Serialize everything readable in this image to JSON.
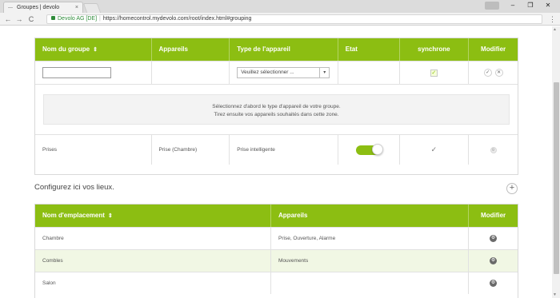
{
  "browser": {
    "tab_title": "Groupes | devolo",
    "tab_close": "×",
    "window_minimize": "–",
    "window_maximize": "❐",
    "window_close": "✕",
    "nav_back": "←",
    "nav_forward": "→",
    "nav_reload": "C",
    "secure_label": "Devolo AG [DE]",
    "url": "https://homecontrol.mydevolo.com/root/index.html#grouping",
    "bookmark_star": "☆",
    "menu_icon": "⋮"
  },
  "groups_table": {
    "headers": {
      "name": "Nom du groupe",
      "devices": "Appareils",
      "device_type": "Type de l'appareil",
      "state": "Etat",
      "sync": "synchrone",
      "modify": "Modifier"
    },
    "sort_icon": "⇕",
    "new_group": {
      "name_value": "",
      "device_type_placeholder": "Veuillez sélectionner ...",
      "caret": "▾",
      "sync_mark": "✓",
      "confirm": "✓",
      "cancel": "✕"
    },
    "dropzone_line1": "Sélectionnez d'abord le type d'appareil de votre groupe.",
    "dropzone_line2": "Tirez ensuite vos appareils souhaités dans cette zone.",
    "rows": [
      {
        "name": "Prises",
        "devices": "Prise (Chambre)",
        "device_type": "Prise intelligente",
        "state_on": true,
        "sync_mark": "✓",
        "modify_icon": "⚙"
      }
    ]
  },
  "locations": {
    "section_title": "Configurez ici vos lieux.",
    "add_label": "+",
    "headers": {
      "name": "Nom d'emplacement",
      "devices": "Appareils",
      "modify": "Modifier"
    },
    "sort_icon": "⇕",
    "rows": [
      {
        "name": "Chambre",
        "devices": "Prise, Ouverture, Alarme",
        "modify_icon": "⚙"
      },
      {
        "name": "Combles",
        "devices": "Mouvements",
        "modify_icon": "⚙"
      },
      {
        "name": "Salon",
        "devices": "",
        "modify_icon": "⚙"
      }
    ]
  },
  "colors": {
    "accent": "#8cbe12",
    "row_alt": "#f1f7e4"
  }
}
